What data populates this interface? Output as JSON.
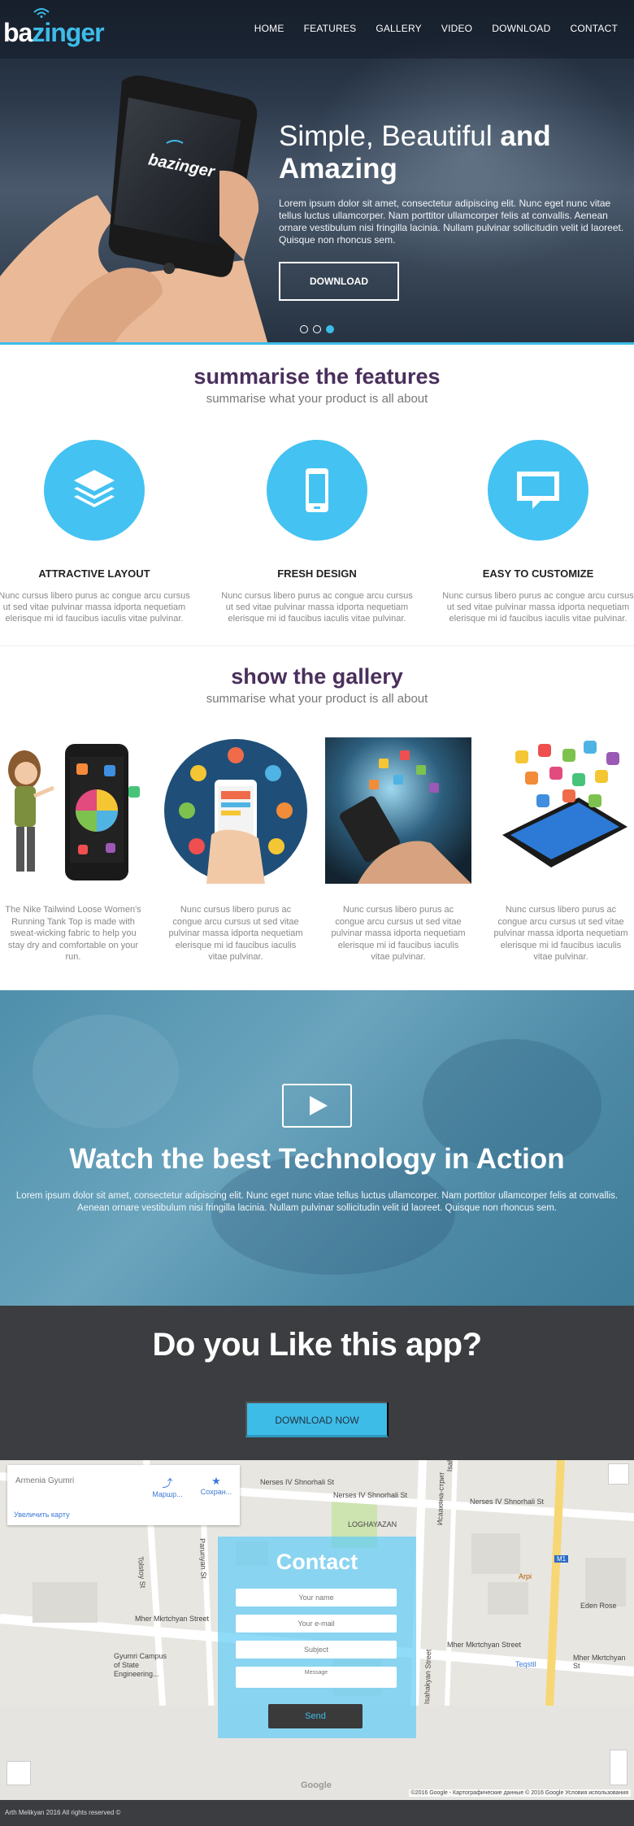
{
  "nav": {
    "logo_part1": "ba",
    "logo_part2": "zinger",
    "items": [
      "HOME",
      "FEATURES",
      "GALLERY",
      "VIDEO",
      "DOWNLOAD",
      "CONTACT"
    ]
  },
  "hero": {
    "title_light": "Simple, Beautiful ",
    "title_bold1": "and",
    "title_bold2": "Amazing",
    "text": "Lorem ipsum dolor sit amet, consectetur adipiscing elit. Nunc eget nunc vitae tellus luctus ullamcorper. Nam porttitor ullamcorper felis at convallis. Aenean ornare vestibulum nisi fringilla lacinia. Nullam pulvinar sollicitudin velit id laoreet. Quisque non rhoncus sem.",
    "button": "DOWNLOAD",
    "phone_logo": "bazinger",
    "slides": 3,
    "active_slide": 3
  },
  "features": {
    "title": "summarise the features",
    "subtitle": "summarise what your product is all about",
    "items": [
      {
        "title": "ATTRACTIVE LAYOUT",
        "text": "Nunc cursus libero purus ac congue arcu cursus ut sed vitae pulvinar massa idporta nequetiam elerisque mi id faucibus iaculis vitae pulvinar.",
        "icon": "layers-icon"
      },
      {
        "title": "FRESH DESIGN",
        "text": "Nunc cursus libero purus ac congue arcu cursus ut sed vitae pulvinar massa idporta nequetiam elerisque mi id faucibus iaculis vitae pulvinar.",
        "icon": "mobile-icon"
      },
      {
        "title": "EASY TO CUSTOMIZE",
        "text": "Nunc cursus libero purus ac congue arcu cursus ut sed vitae pulvinar massa idporta nequetiam elerisque mi id faucibus iaculis vitae pulvinar.",
        "icon": "chat-icon"
      }
    ]
  },
  "gallery": {
    "title": "show the gallery",
    "subtitle": "summarise what your product is all about",
    "items": [
      {
        "text": "The Nike Tailwind Loose Women's Running Tank Top is made with sweat-wicking fabric to help you stay dry and comfortable on your run."
      },
      {
        "text": "Nunc cursus libero purus ac congue arcu cursus ut sed vitae pulvinar massa idporta nequetiam elerisque mi id faucibus iaculis vitae pulvinar."
      },
      {
        "text": "Nunc cursus libero purus ac congue arcu cursus ut sed vitae pulvinar massa idporta nequetiam elerisque mi id faucibus iaculis vitae pulvinar."
      },
      {
        "text": "Nunc cursus libero purus ac congue arcu cursus ut sed vitae pulvinar massa idporta nequetiam elerisque mi id faucibus iaculis vitae pulvinar."
      }
    ]
  },
  "video": {
    "title_light": "Watch the best Technology in ",
    "title_bold": "Action",
    "text": "Lorem ipsum dolor sit amet, consectetur adipiscing elit. Nunc eget nunc vitae tellus luctus ullamcorper. Nam porttitor ullamcorper felis at convallis. Aenean ornare vestibulum nisi fringilla lacinia. Nullam pulvinar sollicitudin velit id laoreet. Quisque non rhoncus sem."
  },
  "cta": {
    "title": "Do you Like this app?",
    "button": "DOWNLOAD NOW"
  },
  "map": {
    "address": "Armenia Gyumri",
    "route_label": "Маршр...",
    "save_label": "Сохран...",
    "enlarge_label": "Увеличить карту",
    "labels": {
      "street1": "Nerses IV Shnorhali St",
      "street2": "Nerses IV Shnorhali St",
      "street3": "Nerses IV Shnorhali St",
      "street4": "Mher Mkrtchyan Street",
      "street5": "Mher Mkrtchyan Street",
      "street6": "Mher Mkrtchyan St",
      "street7": "Isahakyan St",
      "street8": "Tolstoy St",
      "street9": "Parunyan St",
      "street10": "Isahakyan Street",
      "place1": "LOGHAYAZAN",
      "place2": "Arpi",
      "place3": "Eden Rose",
      "place4": "Teqstil",
      "place5": "Gyumri Campus of State Engineering...",
      "road_badge": "M1",
      "street_ru": "Исаакяна-стрит"
    },
    "google": "Google",
    "copyright": "©2016 Google - Картографические данные © 2016 Google   Условия использования"
  },
  "contact": {
    "title": "Contact",
    "name_placeholder": "Your name",
    "email_placeholder": "Your e-mail",
    "subject_placeholder": "Subject",
    "message_placeholder": "Message",
    "send": "Send"
  },
  "footer": {
    "text": "Arth Melikyan 2016 All rights reserved ©"
  },
  "colors": {
    "accent": "#3dbce8",
    "feature_circle": "#44c2f2",
    "title_purple": "#4a2f5c",
    "dark_band": "#3b3d40"
  }
}
